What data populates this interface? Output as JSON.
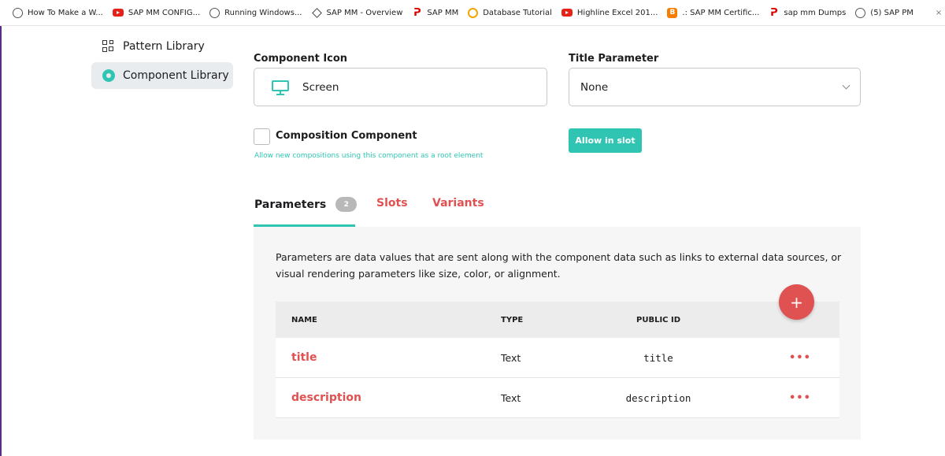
{
  "bookmarks": [
    {
      "label": "How To Make a W...",
      "icon": "globe-icon"
    },
    {
      "label": "SAP MM CONFIG...",
      "icon": "youtube-icon"
    },
    {
      "label": "Running Windows...",
      "icon": "globe-icon"
    },
    {
      "label": "SAP MM - Overview",
      "icon": "diamond-icon"
    },
    {
      "label": "SAP MM",
      "icon": "sap-icon"
    },
    {
      "label": "Database Tutorial",
      "icon": "database-icon"
    },
    {
      "label": "Highline Excel 201...",
      "icon": "youtube-icon"
    },
    {
      "label": ".: SAP MM Certific...",
      "icon": "blogger-icon"
    },
    {
      "label": "sap mm Dumps",
      "icon": "sap-icon"
    },
    {
      "label": "(5) SAP PM",
      "icon": "globe-icon"
    }
  ],
  "sidebar": {
    "items": [
      {
        "label": "Pattern Library",
        "icon": "grid-icon"
      },
      {
        "label": "Component Library",
        "icon": "gear-icon",
        "active": true
      }
    ]
  },
  "form": {
    "component_icon_label": "Component Icon",
    "component_icon_value": "Screen",
    "title_param_label": "Title Parameter",
    "title_param_value": "None",
    "composition_label": "Composition Component",
    "composition_hint": "Allow new compositions using this component as a root element",
    "allow_in_slot": "Allow in slot"
  },
  "tabs": [
    {
      "label": "Parameters",
      "badge": "2",
      "active": true
    },
    {
      "label": "Slots"
    },
    {
      "label": "Variants"
    }
  ],
  "panel": {
    "description": "Parameters are data values that are sent along with the component data such as links to external data sources, or visual rendering parameters like size, color, or alignment.",
    "add_label": "+"
  },
  "table": {
    "columns": [
      "NAME",
      "TYPE",
      "PUBLIC ID"
    ],
    "rows": [
      {
        "name": "title",
        "type": "Text",
        "public_id": "title",
        "actions": "•••"
      },
      {
        "name": "description",
        "type": "Text",
        "public_id": "description",
        "actions": "•••"
      }
    ]
  },
  "colors": {
    "accent": "#2fc5b2",
    "danger": "#e05151"
  }
}
